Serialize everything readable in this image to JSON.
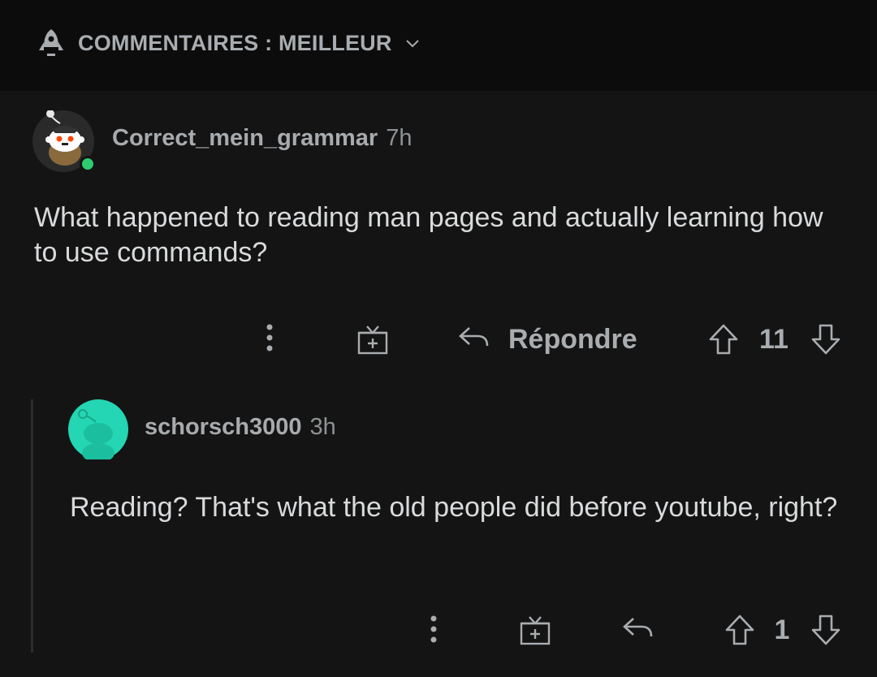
{
  "sort_bar": {
    "label": "COMMENTAIRES : MEILLEUR",
    "icon": "rocket-icon",
    "dropdown_icon": "chevron-down-icon"
  },
  "comments": [
    {
      "username": "Correct_mein_grammar",
      "time": "7h",
      "online": true,
      "body": "What happened to reading man pages and actually learning how to use commands?",
      "reply_label": "Répondre",
      "score": "11"
    },
    {
      "username": "schorsch3000",
      "time": "3h",
      "online": false,
      "body": "Reading? That's what the old people did before youtube, right?",
      "score": "1"
    }
  ],
  "colors": {
    "background": "#141414",
    "header_background": "#0c0c0c",
    "text": "#d8dadc",
    "muted": "#a9adb0",
    "online": "#2ecc71",
    "avatar_teal": "#24d6b4"
  }
}
